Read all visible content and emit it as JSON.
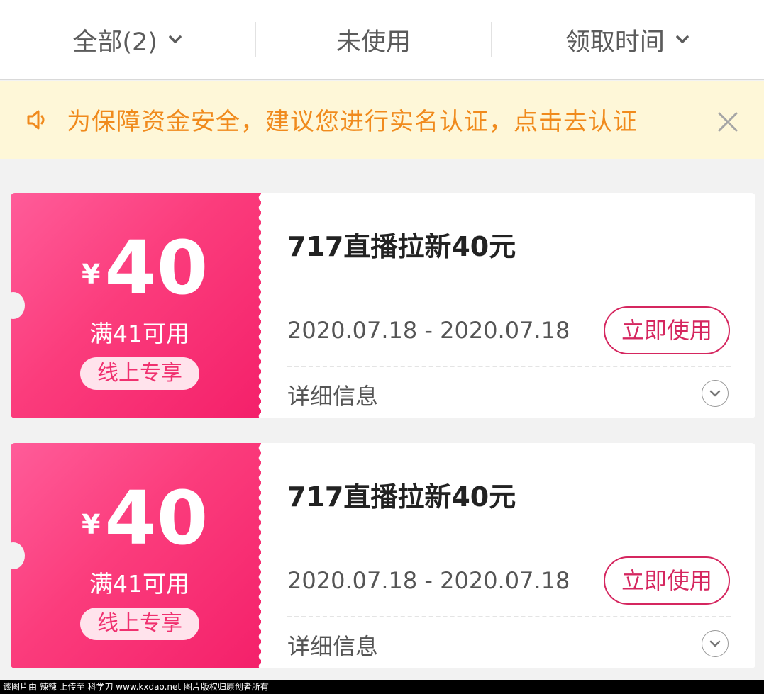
{
  "filter_bar": {
    "all_label": "全部(2)",
    "unused_label": "未使用",
    "sort_label": "领取时间"
  },
  "notice": {
    "text": "为保障资金安全，建议您进行实名认证，点击去认证"
  },
  "coupons": [
    {
      "currency": "¥",
      "amount": "40",
      "condition": "满41可用",
      "tag": "线上专享",
      "title": "717直播拉新40元",
      "date_range": "2020.07.18 - 2020.07.18",
      "use_label": "立即使用",
      "detail_label": "详细信息"
    },
    {
      "currency": "¥",
      "amount": "40",
      "condition": "满41可用",
      "tag": "线上专享",
      "title": "717直播拉新40元",
      "date_range": "2020.07.18 - 2020.07.18",
      "use_label": "立即使用",
      "detail_label": "详细信息"
    }
  ],
  "footer": {
    "watermark": "该图片由 辣辣 上传至 科学刀 www.kxdao.net 图片版权归原创者所有"
  },
  "colors": {
    "accent": "#d5265f",
    "coupon_gradient_start": "#ff5c99",
    "coupon_gradient_end": "#f4206a",
    "notice_text": "#f08a1c",
    "notice_bg": "#fef7d8"
  },
  "icons": {
    "filter_dropdown": "chevron-down-icon",
    "notice": "speaker-icon",
    "notice_close": "close-icon",
    "detail_expand": "chevron-down-circle-icon"
  }
}
